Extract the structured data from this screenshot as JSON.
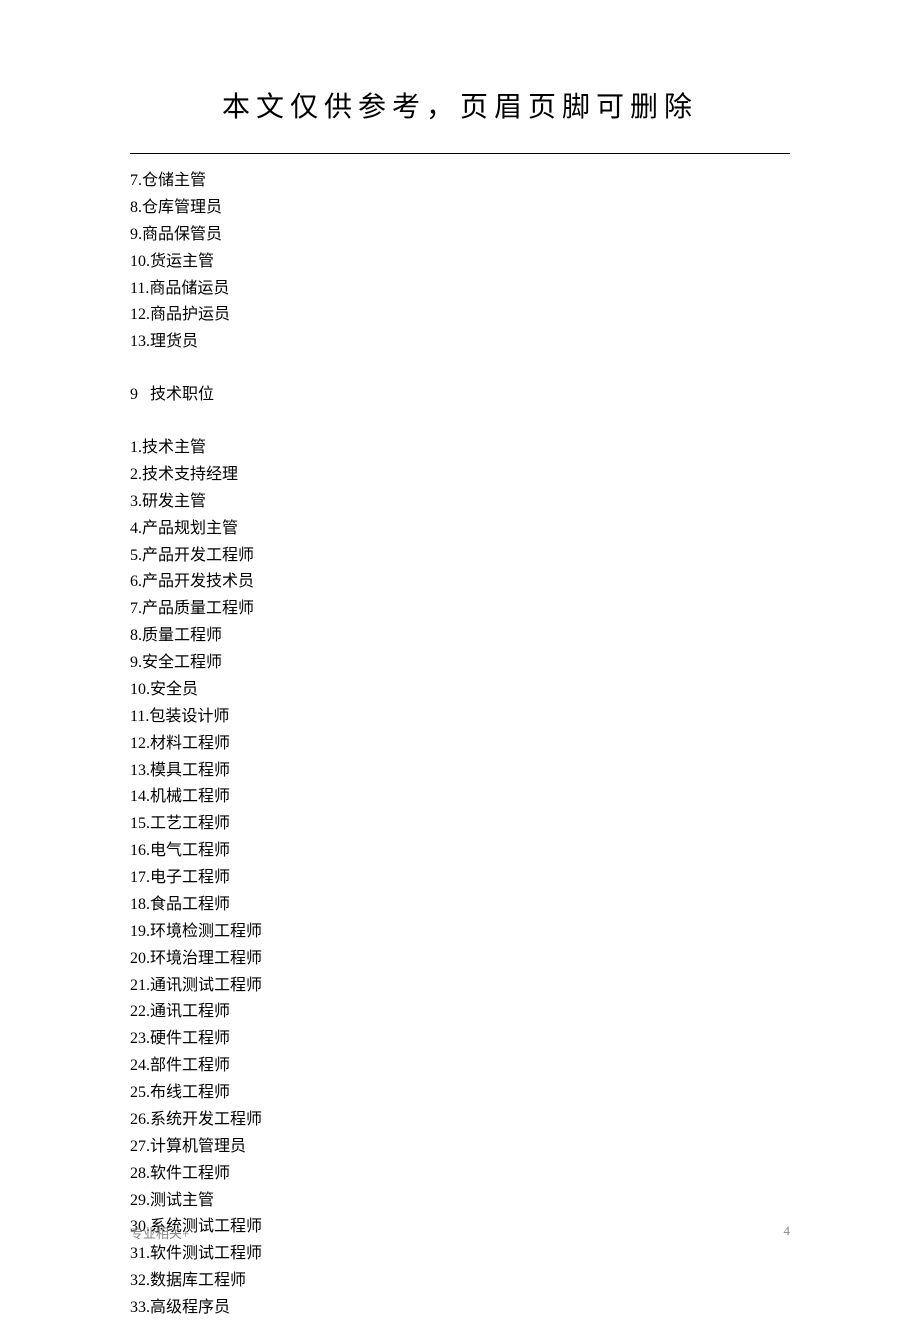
{
  "header": {
    "title": "本文仅供参考，页眉页脚可删除"
  },
  "continued_list": [
    "7.仓储主管",
    "8.仓库管理员",
    "9.商品保管员",
    "10.货运主管",
    "11.商品储运员",
    "12.商品护运员",
    "13.理货员"
  ],
  "section": {
    "number": "9",
    "title": "技术职位"
  },
  "main_list": [
    "1.技术主管",
    "2.技术支持经理",
    "3.研发主管",
    "4.产品规划主管",
    "5.产品开发工程师",
    "6.产品开发技术员",
    "7.产品质量工程师",
    "8.质量工程师",
    "9.安全工程师",
    "10.安全员",
    "11.包装设计师",
    "12.材料工程师",
    "13.模具工程师",
    "14.机械工程师",
    "15.工艺工程师",
    "16.电气工程师",
    "17.电子工程师",
    "18.食品工程师",
    "19.环境检测工程师",
    "20.环境治理工程师",
    "21.通讯测试工程师",
    "22.通讯工程师",
    "23.硬件工程师",
    "24.部件工程师",
    "25.布线工程师",
    "26.系统开发工程师",
    "27.计算机管理员",
    "28.软件工程师",
    "29.测试主管",
    "30.系统测试工程师",
    "31.软件测试工程师",
    "32.数据库工程师",
    "33.高级程序员"
  ],
  "footer": {
    "left": "专业相关+",
    "right": "4"
  }
}
